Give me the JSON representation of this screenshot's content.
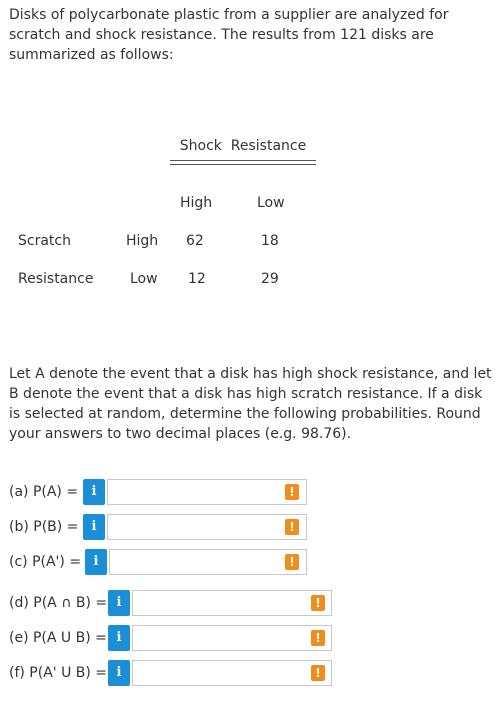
{
  "intro": "Disks of polycarbonate plastic from a supplier are analyzed for scratch and shock resistance. The results from 121 disks are summarized as follows:",
  "table": {
    "column_group_label": "Shock  Resistance",
    "col_high": "High",
    "col_low": "Low",
    "row_group_label_1": "Scratch",
    "row_group_label_2": "Resistance",
    "row_high": "High",
    "row_low": "Low",
    "high_high": "62",
    "high_low": "18",
    "low_high": "12",
    "low_low": "29"
  },
  "problem": "Let A denote the event that a disk has high shock resistance, and let B denote the event that a disk has high scratch resistance. If a disk is selected at random, determine the following probabilities. Round your answers to two decimal places (e.g. 98.76).",
  "questions": [
    {
      "label": "(a) P(A) =",
      "info": "i",
      "value": "",
      "alert": "!"
    },
    {
      "label": "(b) P(B) =",
      "info": "i",
      "value": "",
      "alert": "!"
    },
    {
      "label": "(c) P(A') =",
      "info": "i",
      "value": "",
      "alert": "!"
    },
    {
      "label": "(d) P(A ∩ B) =",
      "info": "i",
      "value": "",
      "alert": "!"
    },
    {
      "label": "(e) P(A U B) =",
      "info": "i",
      "value": "",
      "alert": "!"
    },
    {
      "label": "(f) P(A' U B) =",
      "info": "i",
      "value": "",
      "alert": "!"
    }
  ],
  "colors": {
    "info_button": "#1b8fd6",
    "alert_icon": "#f28c1c",
    "text": "#333333"
  }
}
